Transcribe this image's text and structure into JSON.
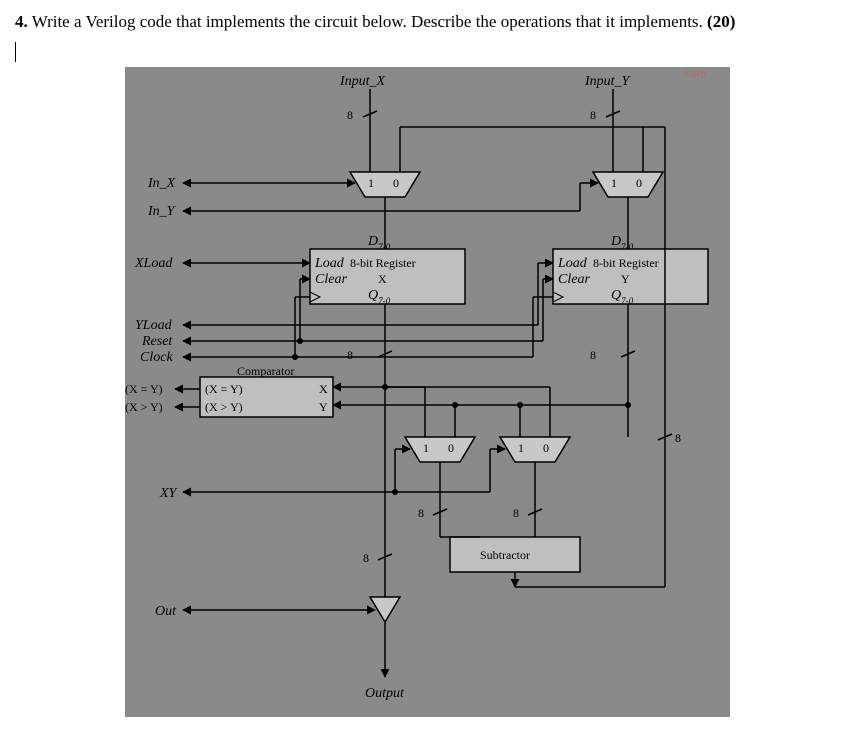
{
  "question": {
    "number": "4.",
    "text_part1": "Write a Verilog code that implements the circuit below. Describe the operations that it implements.",
    "points": "(20)"
  },
  "diagram": {
    "input_x": "Input_X",
    "input_y": "Input_Y",
    "in_x": "In_X",
    "in_y": "In_Y",
    "xload": "XLoad",
    "yload": "YLoad",
    "reset": "Reset",
    "clock": "Clock",
    "xy": "XY",
    "out": "Out",
    "output": "Output",
    "bus8": "8",
    "mux1": "1",
    "mux0": "0",
    "d70": "D7-0",
    "load": "Load",
    "clear": "Clear",
    "reg8bit": "8-bit Register",
    "regx": "X",
    "regy": "Y",
    "q70": "Q7-0",
    "comparator": "Comparator",
    "eq_out": "(X = Y)",
    "gt_out": "(X > Y)",
    "eq_in": "(X = Y)",
    "gt_in": "(X > Y)",
    "compx": "X",
    "compy": "Y",
    "subtractor": "Subtractor",
    "watermark": "ORS"
  }
}
